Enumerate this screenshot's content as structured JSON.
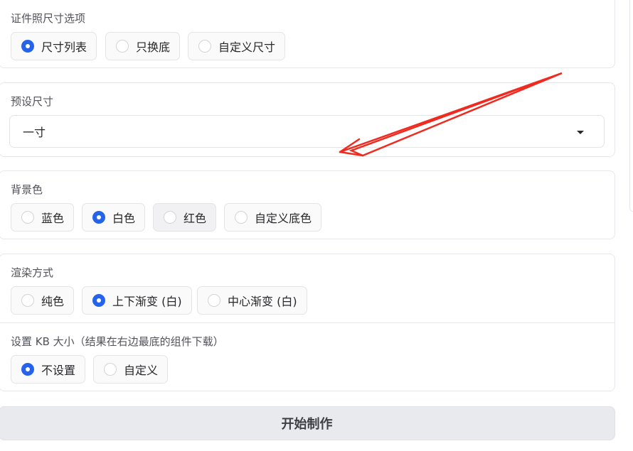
{
  "size_option": {
    "label": "证件照尺寸选项",
    "options": [
      {
        "text": "尺寸列表",
        "selected": true
      },
      {
        "text": "只换底",
        "selected": false
      },
      {
        "text": "自定义尺寸",
        "selected": false
      }
    ]
  },
  "preset_size": {
    "label": "预设尺寸",
    "value": "一寸"
  },
  "background_color": {
    "label": "背景色",
    "options": [
      {
        "text": "蓝色",
        "selected": false
      },
      {
        "text": "白色",
        "selected": true
      },
      {
        "text": "红色",
        "selected": false
      },
      {
        "text": "自定义底色",
        "selected": false
      }
    ]
  },
  "render_mode": {
    "label": "渲染方式",
    "options": [
      {
        "text": "纯色",
        "selected": false
      },
      {
        "text": "上下渐变 (白)",
        "selected": true
      },
      {
        "text": "中心渐变 (白)",
        "selected": false
      }
    ]
  },
  "kb_size": {
    "label": "设置 KB 大小（结果在右边最底的组件下载）",
    "options": [
      {
        "text": "不设置",
        "selected": true
      },
      {
        "text": "自定义",
        "selected": false
      }
    ]
  },
  "start_button": "开始制作",
  "colors": {
    "accent": "#2563eb",
    "annotation_arrow": "#ef2b20"
  }
}
